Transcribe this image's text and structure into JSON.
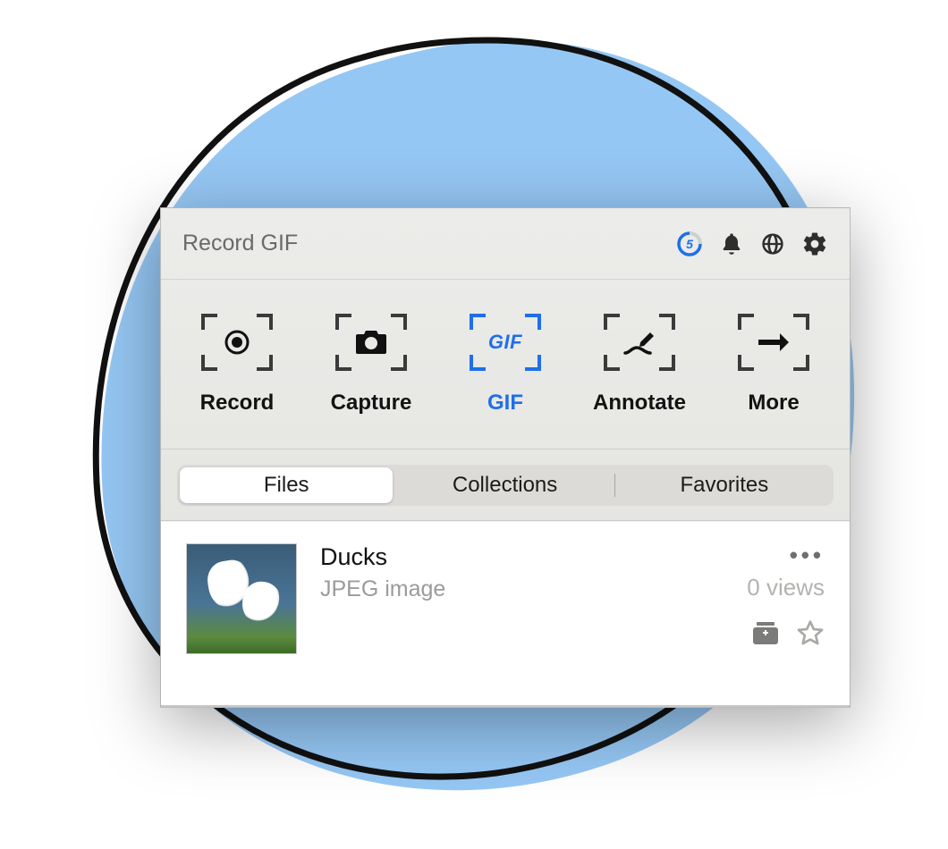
{
  "header": {
    "title": "Record GIF",
    "countdown_value": "5"
  },
  "toolbar": [
    {
      "label": "Record",
      "icon": "record-dot-icon",
      "active": false
    },
    {
      "label": "Capture",
      "icon": "camera-icon",
      "active": false
    },
    {
      "label": "GIF",
      "icon": "gif-text-icon",
      "active": true
    },
    {
      "label": "Annotate",
      "icon": "pencil-line-icon",
      "active": false
    },
    {
      "label": "More",
      "icon": "arrow-right-icon",
      "active": false
    }
  ],
  "tabs": {
    "files": "Files",
    "collections": "Collections",
    "favorites": "Favorites",
    "active": "files"
  },
  "item": {
    "title": "Ducks",
    "subtitle": "JPEG image",
    "views": "0 views"
  }
}
